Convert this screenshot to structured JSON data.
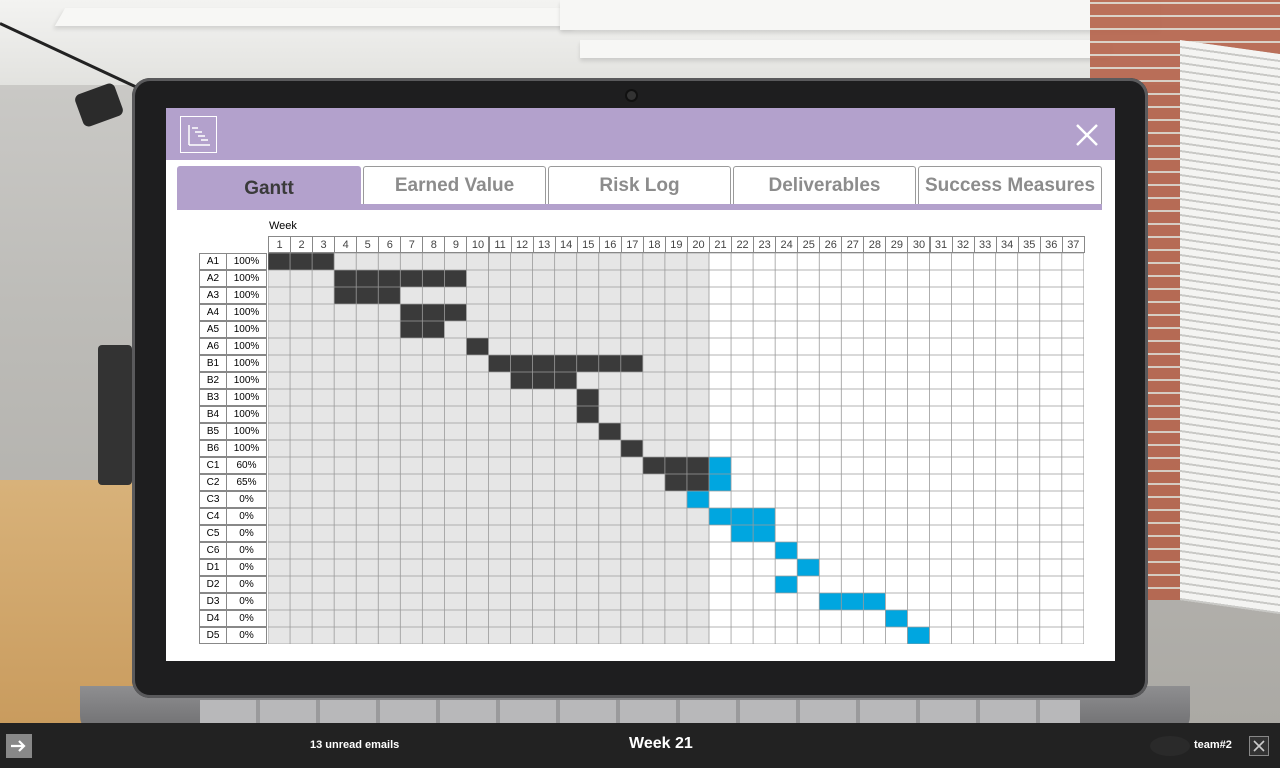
{
  "app": {
    "tabs": [
      "Gantt",
      "Earned Value",
      "Risk Log",
      "Deliverables",
      "Success Measures"
    ],
    "active_tab": "Gantt"
  },
  "gantt": {
    "week_label": "Week",
    "weeks": [
      1,
      2,
      3,
      4,
      5,
      6,
      7,
      8,
      9,
      10,
      11,
      12,
      13,
      14,
      15,
      16,
      17,
      18,
      19,
      20,
      21,
      22,
      23,
      24,
      25,
      26,
      27,
      28,
      29,
      30,
      31,
      32,
      33,
      34,
      35,
      36,
      37
    ],
    "current_week": 21,
    "colors": {
      "done": "#3a3a3a",
      "planned": "#00a6e0",
      "past_bg": "#e6e6e6",
      "future_bg": "#ffffff"
    },
    "tasks": [
      {
        "id": "A1",
        "pct": "100%",
        "done": [
          1,
          2,
          3
        ],
        "planned": []
      },
      {
        "id": "A2",
        "pct": "100%",
        "done": [
          4,
          5,
          6,
          7,
          8,
          9
        ],
        "planned": []
      },
      {
        "id": "A3",
        "pct": "100%",
        "done": [
          4,
          5,
          6
        ],
        "planned": []
      },
      {
        "id": "A4",
        "pct": "100%",
        "done": [
          7,
          8,
          9
        ],
        "planned": []
      },
      {
        "id": "A5",
        "pct": "100%",
        "done": [
          7,
          8
        ],
        "planned": []
      },
      {
        "id": "A6",
        "pct": "100%",
        "done": [
          10
        ],
        "planned": []
      },
      {
        "id": "B1",
        "pct": "100%",
        "done": [
          11,
          12,
          13,
          14,
          15,
          16,
          17
        ],
        "planned": []
      },
      {
        "id": "B2",
        "pct": "100%",
        "done": [
          12,
          13,
          14
        ],
        "planned": []
      },
      {
        "id": "B3",
        "pct": "100%",
        "done": [
          15
        ],
        "planned": []
      },
      {
        "id": "B4",
        "pct": "100%",
        "done": [
          15
        ],
        "planned": []
      },
      {
        "id": "B5",
        "pct": "100%",
        "done": [
          16
        ],
        "planned": []
      },
      {
        "id": "B6",
        "pct": "100%",
        "done": [
          17
        ],
        "planned": []
      },
      {
        "id": "C1",
        "pct": "60%",
        "done": [
          18,
          19,
          20
        ],
        "planned": [
          21
        ]
      },
      {
        "id": "C2",
        "pct": "65%",
        "done": [
          19,
          20
        ],
        "planned": [
          21
        ]
      },
      {
        "id": "C3",
        "pct": "0%",
        "done": [],
        "planned": [
          20
        ]
      },
      {
        "id": "C4",
        "pct": "0%",
        "done": [],
        "planned": [
          21,
          22,
          23
        ]
      },
      {
        "id": "C5",
        "pct": "0%",
        "done": [],
        "planned": [
          22,
          23
        ]
      },
      {
        "id": "C6",
        "pct": "0%",
        "done": [],
        "planned": [
          24
        ]
      },
      {
        "id": "D1",
        "pct": "0%",
        "done": [],
        "planned": [
          25
        ]
      },
      {
        "id": "D2",
        "pct": "0%",
        "done": [],
        "planned": [
          24
        ]
      },
      {
        "id": "D3",
        "pct": "0%",
        "done": [],
        "planned": [
          26,
          27,
          28
        ]
      },
      {
        "id": "D4",
        "pct": "0%",
        "done": [],
        "planned": [
          29
        ]
      },
      {
        "id": "D5",
        "pct": "0%",
        "done": [],
        "planned": [
          30
        ]
      }
    ]
  },
  "footer": {
    "emails": "13 unread emails",
    "week": "Week 21",
    "team": "team#2"
  }
}
